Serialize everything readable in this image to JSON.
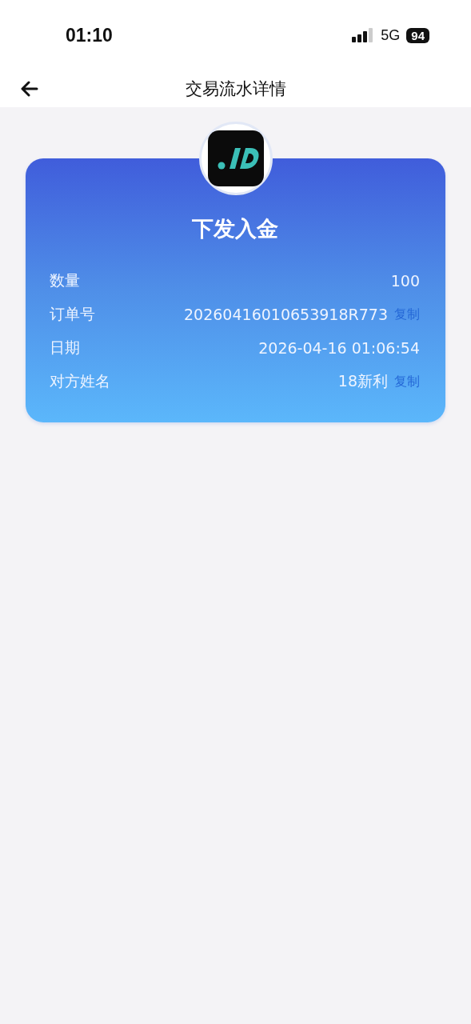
{
  "status_bar": {
    "time": "01:10",
    "network": "5G",
    "battery": "94"
  },
  "nav": {
    "title": "交易流水详情"
  },
  "card": {
    "title": "下发入金",
    "rows": [
      {
        "label": "数量",
        "value": "100"
      },
      {
        "label": "订单号",
        "value": "20260416010653918R773",
        "copy": "复制"
      },
      {
        "label": "日期",
        "value": "2026-04-16 01:06:54"
      },
      {
        "label": "对方姓名",
        "value": "18新利",
        "copy": "复制"
      }
    ]
  }
}
